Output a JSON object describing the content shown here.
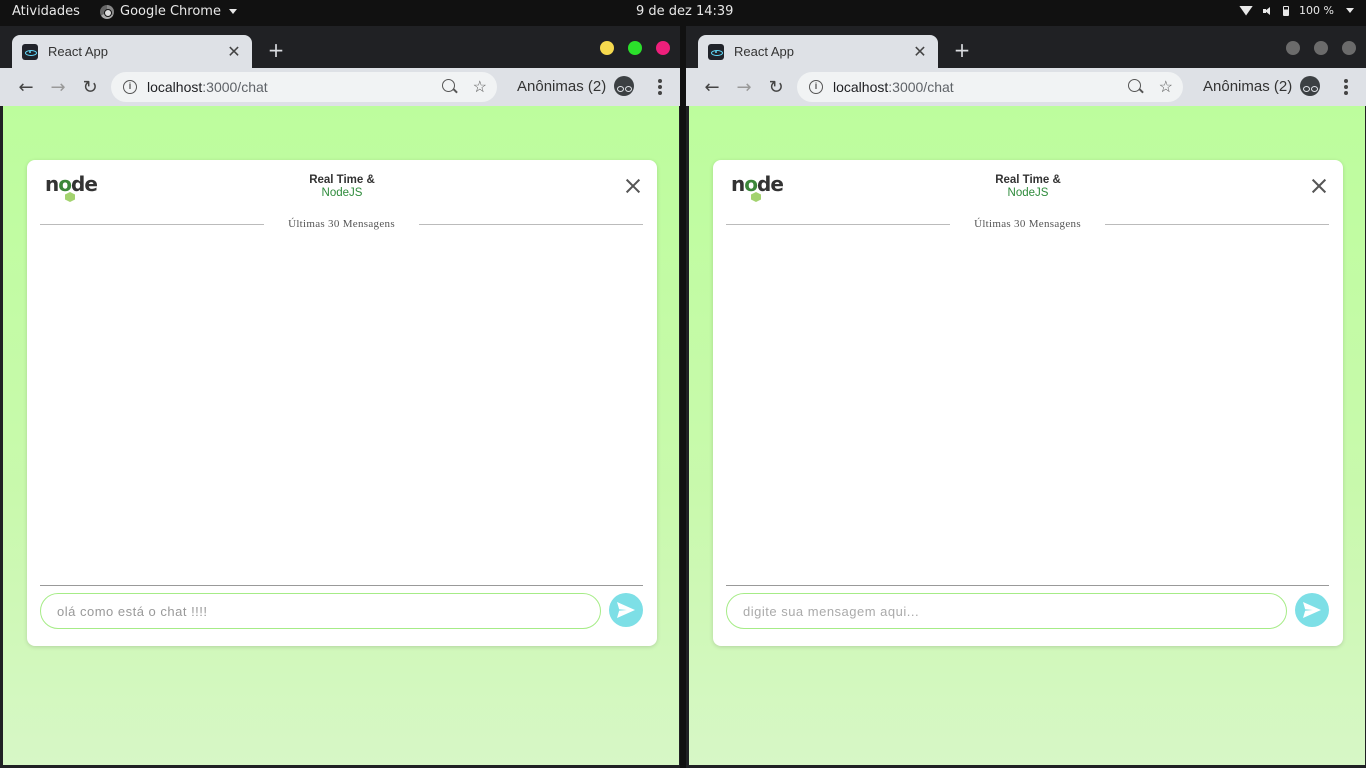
{
  "topbar": {
    "activities": "Atividades",
    "app_name": "Google Chrome",
    "clock": "9 de dez  14:39",
    "battery": "100 %"
  },
  "windows": [
    {
      "tab_title": "React App",
      "url_host": "localhost",
      "url_path": ":3000/chat",
      "incognito_label": "Anônimas (2)",
      "window_buttons": [
        "#f5d94e",
        "#2be02b",
        "#ee1f7b"
      ],
      "chat": {
        "logo_text": "node",
        "title_line1": "Real Time &",
        "title_line2": "NodeJS",
        "divider_label": "Últimas 30 Mensagens",
        "input_value": "olá como está o chat !!!!",
        "input_placeholder": "digite sua mensagem aqui..."
      }
    },
    {
      "tab_title": "React App",
      "url_host": "localhost",
      "url_path": ":3000/chat",
      "incognito_label": "Anônimas (2)",
      "window_buttons": [
        "#6b6b6b",
        "#6b6b6b",
        "#6b6b6b"
      ],
      "chat": {
        "logo_text": "node",
        "title_line1": "Real Time &",
        "title_line2": "NodeJS",
        "divider_label": "Últimas 30 Mensagens",
        "input_value": "",
        "input_placeholder": "digite sua mensagem aqui..."
      }
    }
  ],
  "icons": {
    "send": "send-icon",
    "close": "close-icon",
    "search_zoom": "zoom-icon",
    "bookmark": "star-icon",
    "incognito": "incognito-icon",
    "menu": "more-vert-icon"
  }
}
